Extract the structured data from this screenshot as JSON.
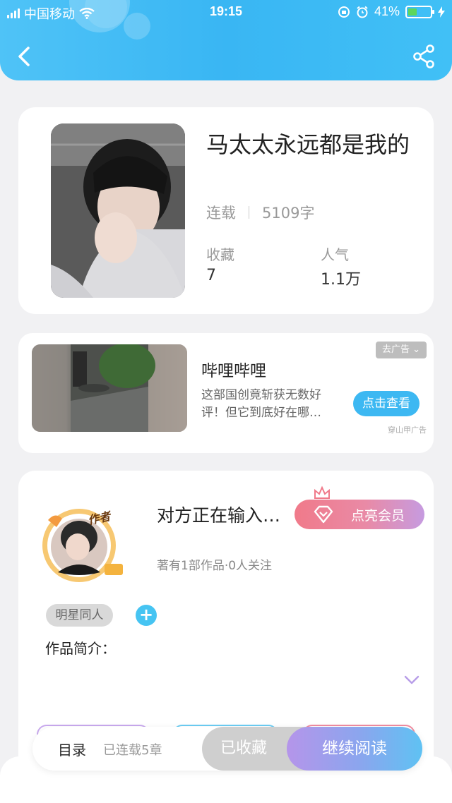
{
  "status_bar": {
    "carrier": "中国移动",
    "time": "19:15",
    "battery": "41%",
    "battery_level": 0.41
  },
  "book": {
    "title": "马太太永远都是我的",
    "status": "连载",
    "word_count": "5109字",
    "favorites_label": "收藏",
    "favorites_value": "7",
    "popularity_label": "人气",
    "popularity_value": "1.1万"
  },
  "ad": {
    "title": "哔哩哔哩",
    "description": "这部国创竟斩获无数好评！但它到底好在哪…",
    "remove_label": "去广告",
    "cta_label": "点击查看",
    "source": "穿山甲广告"
  },
  "author": {
    "avatar_badge": "作者",
    "name": "对方正在输入…",
    "vip_label": "点亮会员",
    "meta": "著有1部作品·0人关注",
    "tag": "明星同人",
    "tag_add": "+",
    "intro_label": "作品简介："
  },
  "bottom_bar": {
    "toc_label": "目录",
    "chapters": "已连载5章",
    "collected_label": "已收藏",
    "continue_label": "继续阅读"
  },
  "colors": {
    "header": "#4fc3f7",
    "accent": "#3db8f2",
    "vip": "#f07a8a"
  }
}
